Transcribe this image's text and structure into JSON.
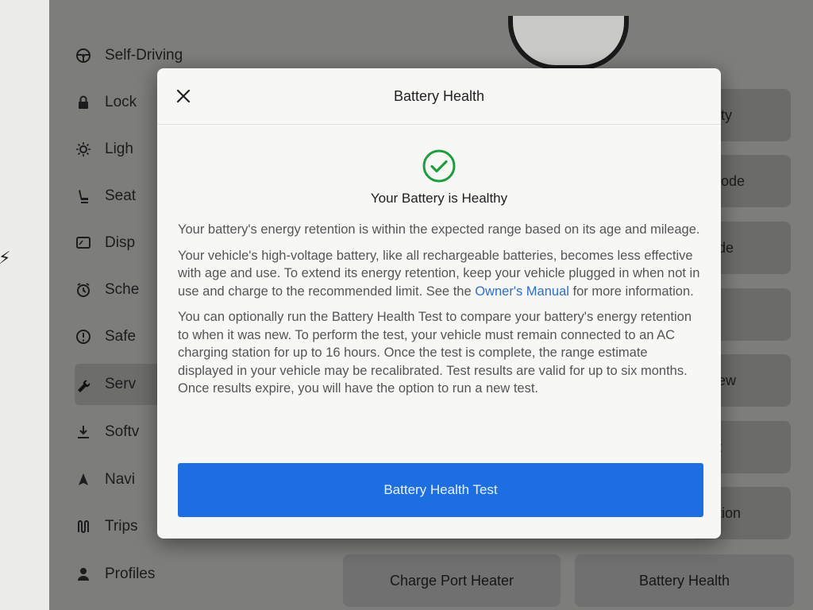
{
  "sidebar": {
    "items": [
      {
        "label": "Self-Driving",
        "icon": "steering-wheel-icon"
      },
      {
        "label": "Lock",
        "icon": "lock-icon"
      },
      {
        "label": "Ligh",
        "icon": "light-icon"
      },
      {
        "label": "Seat",
        "icon": "seat-icon"
      },
      {
        "label": "Disp",
        "icon": "display-icon"
      },
      {
        "label": "Sche",
        "icon": "schedule-icon"
      },
      {
        "label": "Safe",
        "icon": "safety-icon"
      },
      {
        "label": "Serv",
        "icon": "wrench-icon"
      },
      {
        "label": "Softv",
        "icon": "download-icon"
      },
      {
        "label": "Navi",
        "icon": "navigation-icon"
      },
      {
        "label": "Trips",
        "icon": "trips-icon"
      },
      {
        "label": "Profiles",
        "icon": "profile-icon"
      }
    ]
  },
  "right_buttons": [
    "ity",
    "lode",
    "de",
    "",
    "ew",
    "t",
    "tion"
  ],
  "bottom_buttons": {
    "charge_port_heater": "Charge Port Heater",
    "battery_health": "Battery Health"
  },
  "modal": {
    "title": "Battery Health",
    "status": "Your Battery is Healthy",
    "para1": "Your battery's energy retention is within the expected range based on its age and mileage.",
    "para2_before_link": "Your vehicle's high-voltage battery, like all rechargeable batteries, becomes less effective with age and use. To extend its energy retention, keep your vehicle plugged in when not in use and charge to the recommended limit. See the ",
    "para2_link": "Owner's Manual",
    "para2_after_link": " for more information.",
    "para3": "You can optionally run the Battery Health Test to compare your battery's energy retention to when it was new. To perform the test, your vehicle must remain connected to an AC charging station for up to 16 hours. Once the test is complete, the range estimate displayed in your vehicle may be recalibrated. Test results are valid for up to six months. Once results expire, you will have the option to run a new test.",
    "button_label": "Battery Health Test"
  },
  "colors": {
    "accent": "#1d6ee0",
    "link": "#2f6fc3",
    "healthy": "#1f9d3e"
  }
}
